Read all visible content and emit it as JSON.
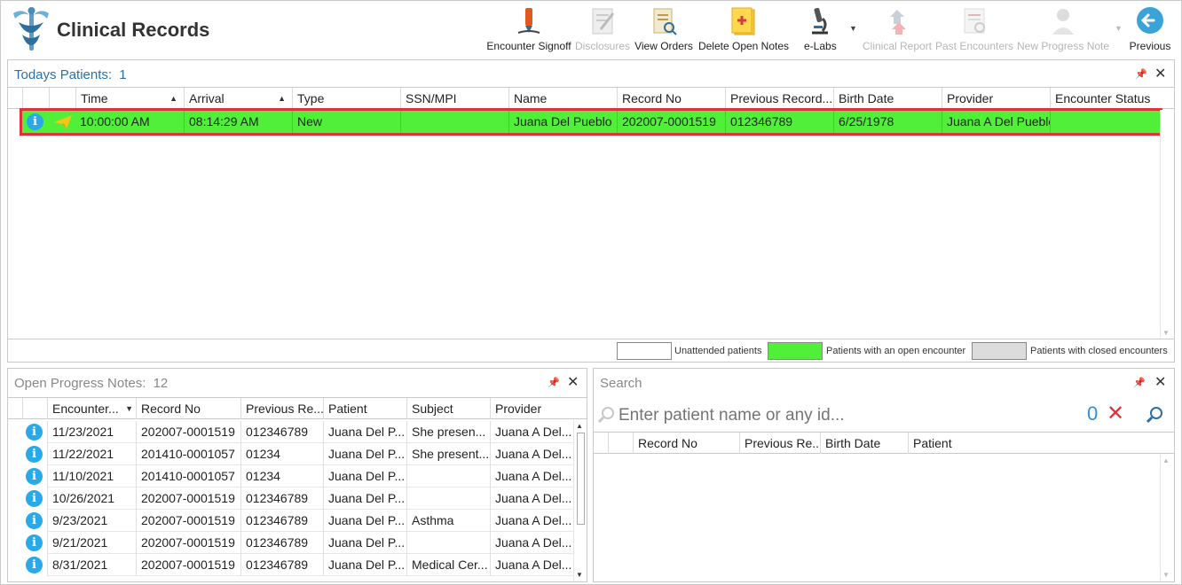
{
  "app": {
    "title": "Clinical Records"
  },
  "toolbar": {
    "encounter_signoff": "Encounter Signoff",
    "disclosures": "Disclosures",
    "view_orders": "View Orders",
    "delete_open_notes": "Delete Open Notes",
    "elabs": "e-Labs",
    "clinical_report": "Clinical Report",
    "past_encounters": "Past Encounters",
    "new_progress_note": "New Progress Note",
    "previous": "Previous"
  },
  "todays": {
    "title": "Todays Patients:",
    "count": "1",
    "columns": {
      "time": "Time",
      "arrival": "Arrival",
      "type": "Type",
      "ssn": "SSN/MPI",
      "name": "Name",
      "record_no": "Record No",
      "previous_record": "Previous Record...",
      "birth_date": "Birth Date",
      "provider": "Provider",
      "encounter_status": "Encounter Status"
    },
    "rows": [
      {
        "time": "10:00:00 AM",
        "arrival": "08:14:29 AM",
        "type": "New",
        "ssn": "",
        "name": "Juana Del Pueblo",
        "record_no": "202007-0001519",
        "previous_record": "012346789",
        "birth_date": "6/25/1978",
        "provider": "Juana A Del Pueblo",
        "encounter_status": ""
      }
    ],
    "row_color": "#52ef3a",
    "highlight_color": "#e0303a"
  },
  "legend": {
    "unattended": "Unattended patients",
    "open": "Patients with an open encounter",
    "closed": "Patients with closed encounters",
    "open_color": "#52ef3a",
    "closed_color": "#dcdcdc"
  },
  "notes": {
    "title": "Open Progress Notes:",
    "count": "12",
    "columns": {
      "encounter": "Encounter...",
      "record_no": "Record No",
      "previous": "Previous Re...",
      "patient": "Patient",
      "subject": "Subject",
      "provider": "Provider"
    },
    "rows": [
      {
        "encounter": "11/23/2021",
        "record_no": "202007-0001519",
        "previous": "012346789",
        "patient": "Juana Del P...",
        "subject": " She presen...",
        "provider": "Juana A Del..."
      },
      {
        "encounter": "11/22/2021",
        "record_no": "201410-0001057",
        "previous": "01234",
        "patient": "Juana Del P...",
        "subject": "She present...",
        "provider": "Juana A Del..."
      },
      {
        "encounter": "11/10/2021",
        "record_no": "201410-0001057",
        "previous": "01234",
        "patient": "Juana Del P...",
        "subject": "",
        "provider": "Juana A Del..."
      },
      {
        "encounter": "10/26/2021",
        "record_no": "202007-0001519",
        "previous": "012346789",
        "patient": "Juana Del P...",
        "subject": "",
        "provider": "Juana A Del..."
      },
      {
        "encounter": "9/23/2021",
        "record_no": "202007-0001519",
        "previous": "012346789",
        "patient": "Juana Del P...",
        "subject": "Asthma",
        "provider": "Juana A Del..."
      },
      {
        "encounter": "9/21/2021",
        "record_no": "202007-0001519",
        "previous": "012346789",
        "patient": "Juana Del P...",
        "subject": "",
        "provider": "Juana A Del..."
      },
      {
        "encounter": "8/31/2021",
        "record_no": "202007-0001519",
        "previous": "012346789",
        "patient": "Juana Del P...",
        "subject": "Medical Cer...",
        "provider": "Juana A Del..."
      }
    ]
  },
  "search": {
    "title": "Search",
    "placeholder": "Enter patient name or any id...",
    "count": "0",
    "columns": {
      "record_no": "Record No",
      "previous": "Previous Re...",
      "birth_date": "Birth Date",
      "patient": "Patient"
    }
  }
}
